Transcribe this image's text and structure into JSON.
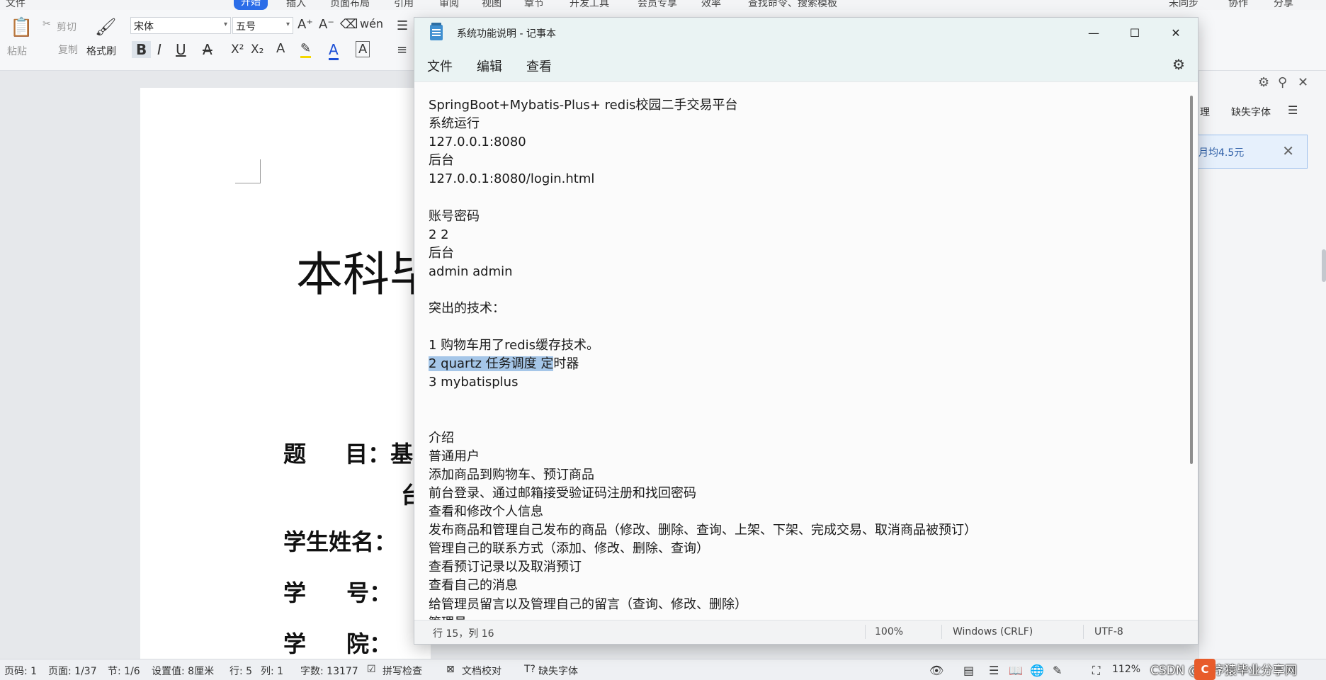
{
  "wps": {
    "menu_items": [
      "文件",
      "开始",
      "插入",
      "页面布局",
      "引用",
      "审阅",
      "视图",
      "章节",
      "开发工具",
      "会员专享",
      "效率",
      "查找命令、搜索模板",
      "未同步",
      "协作",
      "分享"
    ],
    "ribbon": {
      "paste": "粘贴",
      "cut": "剪切",
      "copy": "复制",
      "format_painter": "格式刷",
      "font_name": "宋体",
      "font_size": "五号",
      "bold": "B",
      "italic": "I",
      "underline": "U",
      "superscript": "X²",
      "subscript": "X₂",
      "font_color": "A"
    },
    "document": {
      "title_fragment": "本科毕",
      "fields": [
        {
          "label": "题 目：基",
          "sub": "台"
        },
        {
          "label": "学生姓名："
        },
        {
          "label": "学 号："
        },
        {
          "label": "学 院："
        }
      ]
    },
    "right_panel": {
      "tab_partial": "理",
      "missing_fonts": "缺失字体",
      "notice": "月均4.5元"
    },
    "status": {
      "page_code": "页码: 1",
      "page": "页面: 1/37",
      "section": "节: 1/6",
      "setting": "设置值: 8厘米",
      "row": "行: 5",
      "col": "列: 1",
      "word_count": "字数: 13177",
      "spell_check": "拼写检查",
      "doc_proof": "文档校对",
      "missing_fonts": "缺失字体",
      "zoom": "112%",
      "watermark": "CSDN @程序猿毕业分享网"
    }
  },
  "notepad": {
    "title": "系统功能说明 - 记事本",
    "menus": [
      "文件",
      "编辑",
      "查看"
    ],
    "lines": [
      "SpringBoot+Mybatis-Plus+ redis校园二手交易平台",
      "系统运行",
      "127.0.0.1:8080",
      "后台",
      "127.0.0.1:8080/login.html",
      "",
      "账号密码",
      "2 2",
      "后台",
      "admin admin",
      "",
      "突出的技术：",
      "",
      "1 购物车用了redis缓存技术。",
      "2 quartz 任务调度 定时器",
      "3 mybatisplus",
      "",
      "",
      "介绍",
      "普通用户",
      "添加商品到购物车、预订商品",
      "前台登录、通过邮箱接受验证码注册和找回密码",
      "查看和修改个人信息",
      "发布商品和管理自己发布的商品（修改、删除、查询、上架、下架、完成交易、取消商品被预订）",
      "管理自己的联系方式（添加、修改、删除、查询）",
      "查看预订记录以及取消预订",
      "查看自己的消息",
      "给管理员留言以及管理自己的留言（查询、修改、删除）",
      "管理员"
    ],
    "selected_line_index": 14,
    "selected_prefix": "2 quartz 任务调度 定",
    "selected_rest": "时器",
    "status": {
      "cursor": "行 15，列 16",
      "zoom": "100%",
      "line_ending": "Windows (CRLF)",
      "encoding": "UTF-8"
    }
  }
}
